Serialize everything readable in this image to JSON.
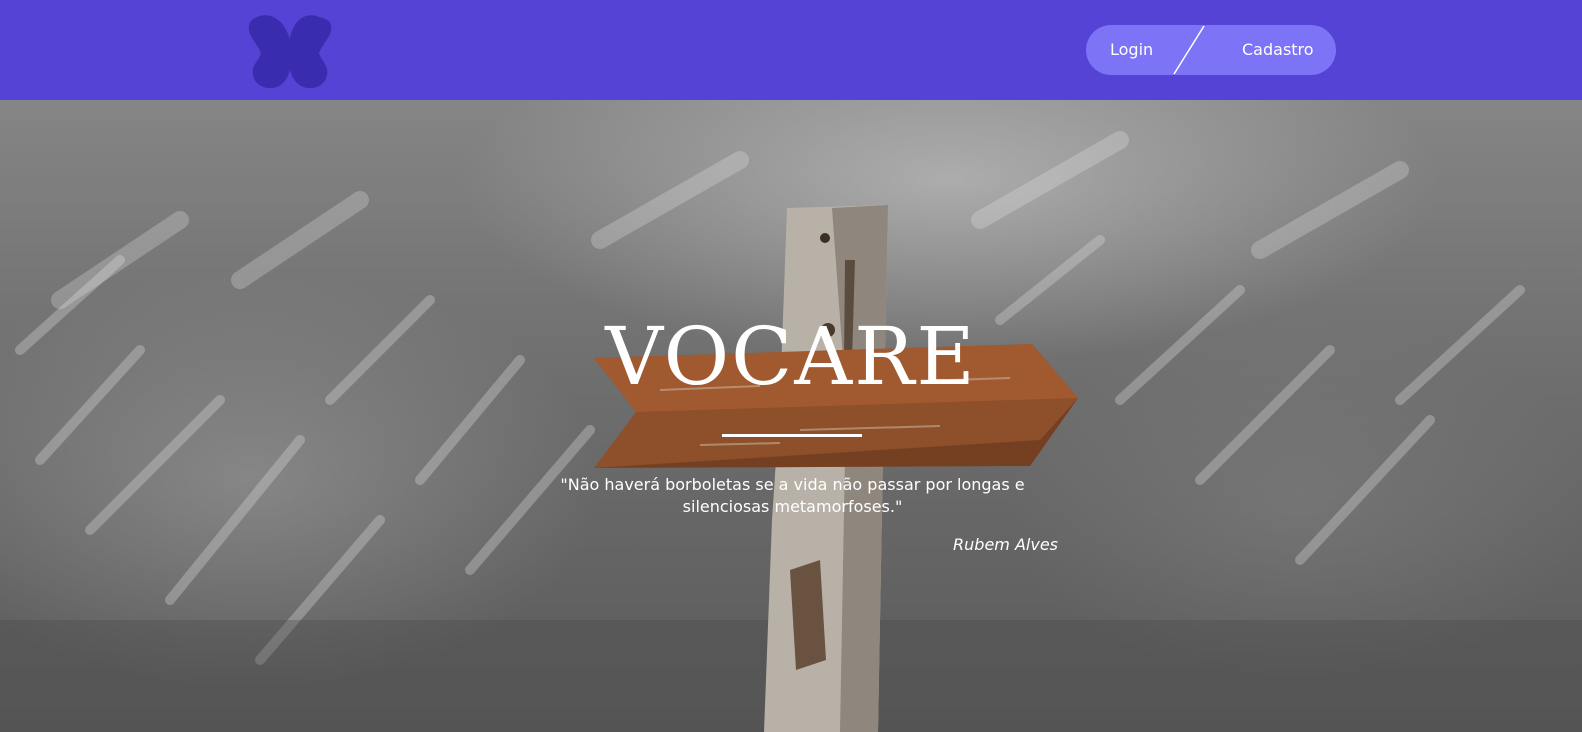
{
  "header": {
    "logo_icon": "butterfly-logo-icon",
    "background_color": "#5443d4",
    "auth": {
      "login_label": "Login",
      "signup_label": "Cadastro",
      "pill_color": "#7d73f7"
    }
  },
  "hero": {
    "background_image": "mountain-signpost-photo",
    "title": "VOCARE",
    "quote": "\"Não haverá borboletas se a vida não passar por longas e silenciosas metamorfoses.\"",
    "author": "Rubem Alves"
  }
}
